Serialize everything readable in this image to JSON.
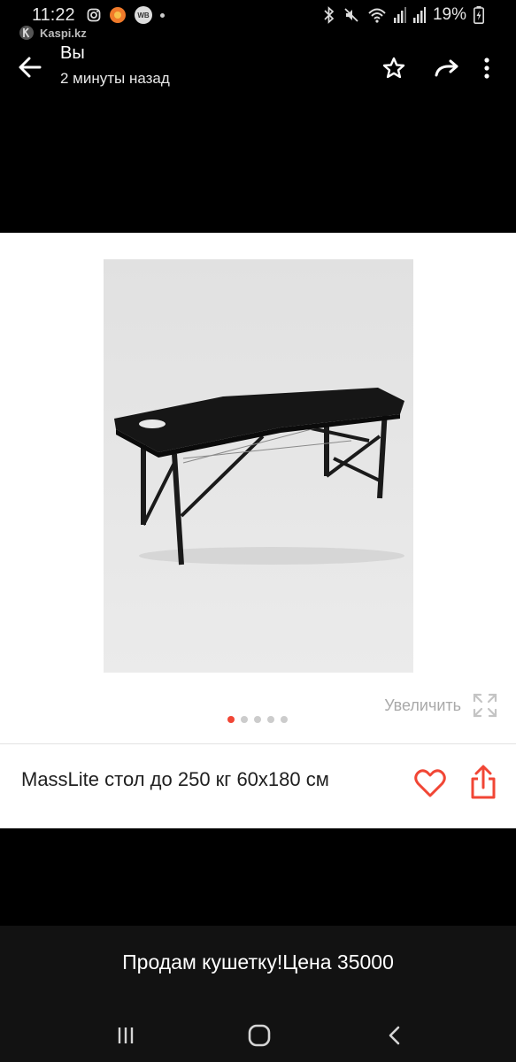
{
  "status_bar": {
    "time": "11:22",
    "notification_app_label": "Kaspi.kz",
    "wb_badge": "WB",
    "battery_percent": "19%"
  },
  "app_bar": {
    "sender": "Вы",
    "timestamp": "2 минуты назад"
  },
  "card": {
    "zoom_label": "Увеличить",
    "product_title": "MassLite стол до 250 кг 60x180 см",
    "pager": {
      "count": 5,
      "active_index": 0
    }
  },
  "message": {
    "text": "Продам кушетку!Цена 35000"
  },
  "colors": {
    "accent_red": "#f14635",
    "background": "#000000",
    "card_background": "#ffffff"
  },
  "icons": {
    "back": "arrow-left-icon",
    "star": "star-icon",
    "forward": "forward-icon",
    "more": "more-vert-icon",
    "zoom": "expand-icon",
    "heart": "heart-icon",
    "share": "share-icon"
  }
}
